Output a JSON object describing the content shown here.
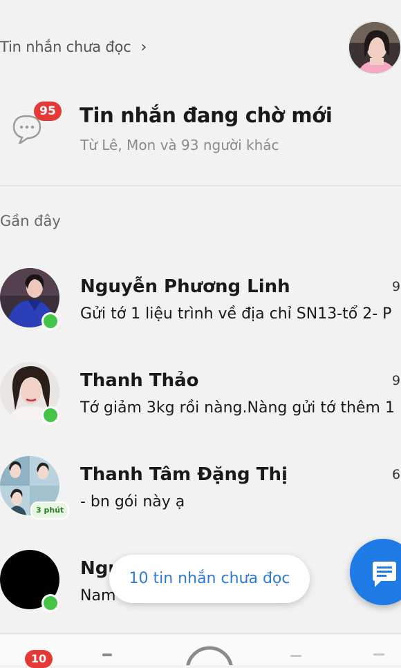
{
  "header": {
    "unread_link": "Tin nhắn chưa đọc",
    "chevron": "›"
  },
  "pending": {
    "badge": "95",
    "title": "Tin nhắn đang chờ mới",
    "subtitle": "Từ Lê, Mon và 93 người khác",
    "icon": "chat-bubble-icon"
  },
  "recent": {
    "heading": "Gần đây"
  },
  "conversations": [
    {
      "name": "Nguyễn Phương Linh",
      "preview": "Gửi tớ 1 liệu trình về địa chỉ SN13-tổ 2- P",
      "time": "9",
      "online": true
    },
    {
      "name": "Thanh Thảo",
      "preview": "Tớ giảm 3kg rồi nàng.Nàng gửi tớ thêm 1",
      "time": "9",
      "online": true
    },
    {
      "name": "Thanh Tâm Đặng Thị",
      "preview": "- bn gói này ạ",
      "time": "6",
      "active_ago": "3 phút"
    },
    {
      "name": "Ngu",
      "preview": "Nam",
      "online": true
    }
  ],
  "floating": {
    "unread_pill": "10 tin nhắn chưa đọc"
  },
  "bottom_nav": {
    "badge": "10"
  },
  "colors": {
    "accent": "#1e7be6",
    "badge_red": "#e53935",
    "online_green": "#44c547",
    "link_blue": "#2c7ad6"
  }
}
